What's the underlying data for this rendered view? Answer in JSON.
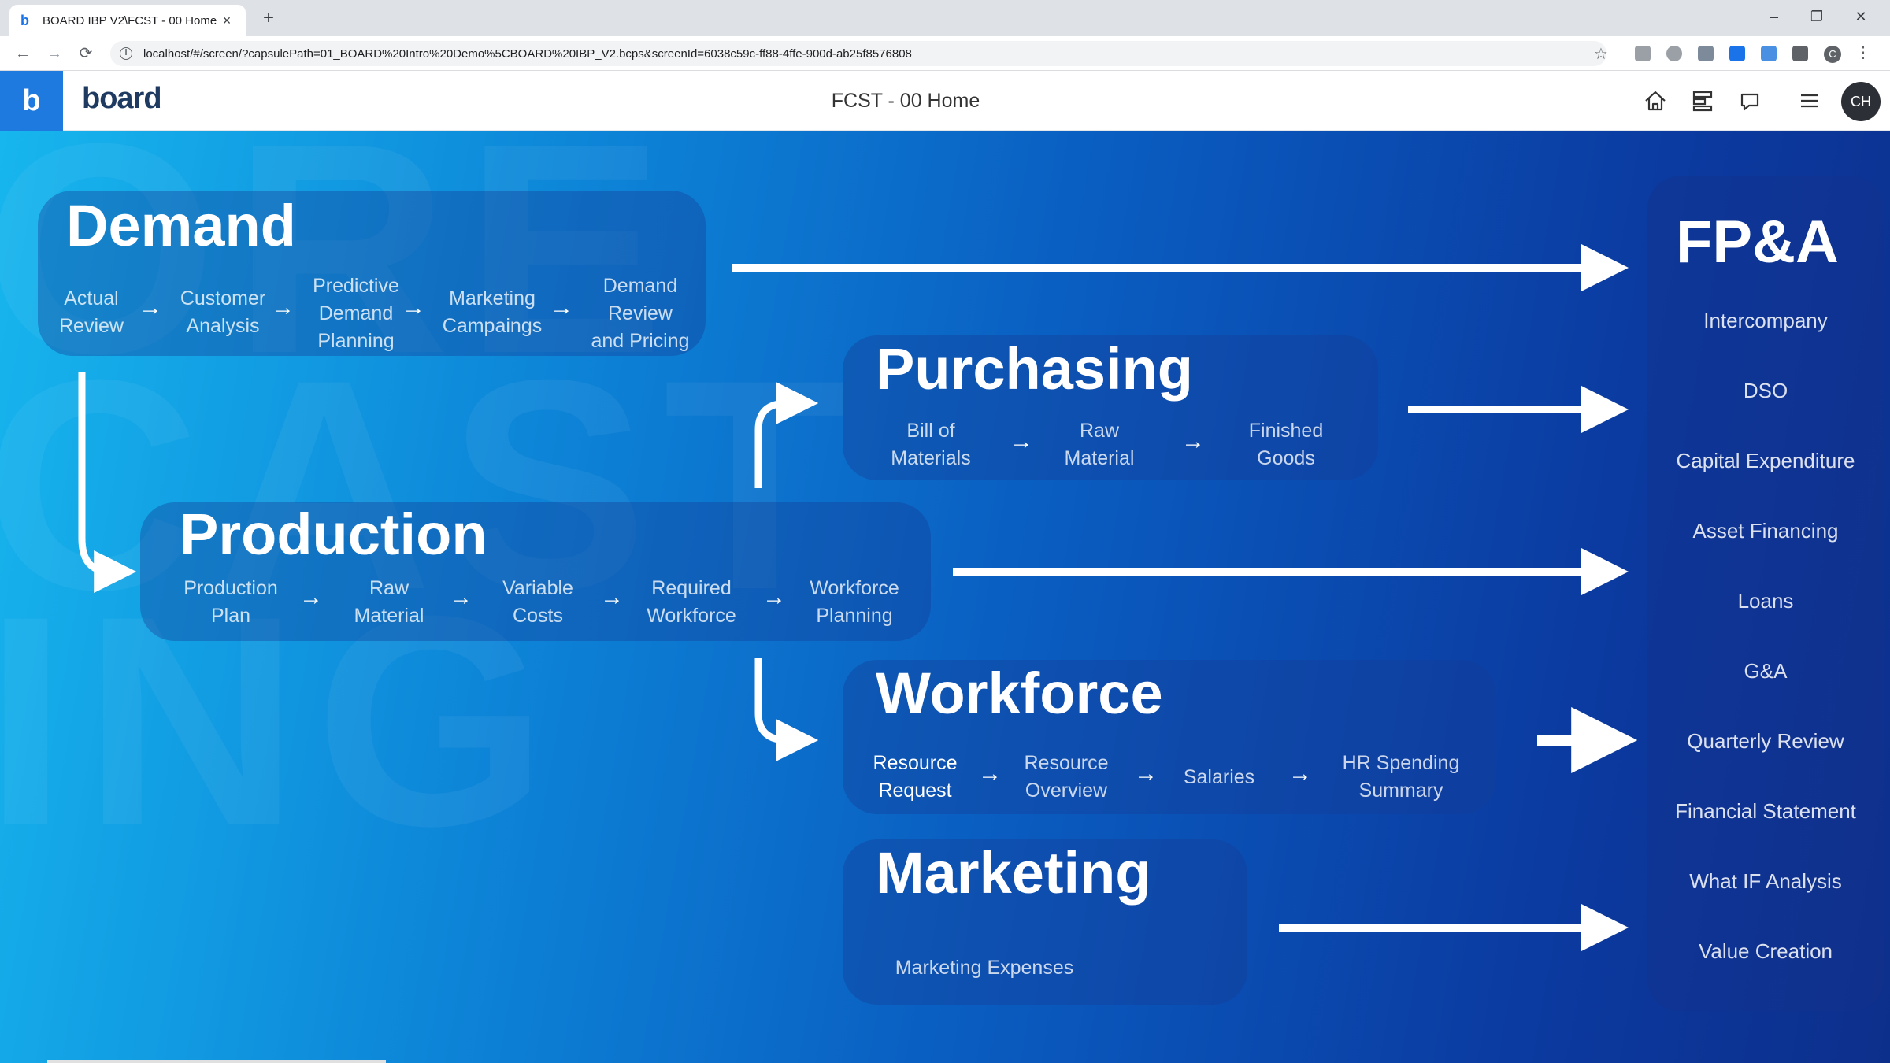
{
  "browser": {
    "tab_title": "BOARD IBP V2\\FCST - 00 Home",
    "tab_close": "×",
    "new_tab": "+",
    "url": "localhost/#/screen/?capsulePath=01_BOARD%20Intro%20Demo%5CBOARD%20IBP_V2.bcps&screenId=6038c59c-ff88-4ffe-900d-ab25f8576808",
    "profile_initial": "C",
    "back": "←",
    "forward": "→",
    "reload": "⟳",
    "minimize": "–",
    "restore": "❐",
    "close": "✕",
    "star": "☆",
    "kebab": "⋮",
    "info": "i"
  },
  "app": {
    "brand_square": "b",
    "logo": "board",
    "screen_title": "FCST - 00 Home",
    "user_initials": "CH"
  },
  "icons": {
    "home": "home-icon",
    "layout": "layout-icon",
    "chat": "chat-icon",
    "menu": "hamburger-menu-icon"
  },
  "watermark": "ORE\nCAST\nING",
  "colors": {
    "brand": "#1f7ae0",
    "bg_left": "#17b6ee",
    "bg_right": "#0d2f8c"
  },
  "demand": {
    "title": "Demand",
    "steps": [
      "Actual\nReview",
      "Customer\nAnalysis",
      "Predictive\nDemand\nPlanning",
      "Marketing\nCampaings",
      "Demand\nReview\nand Pricing"
    ]
  },
  "purchasing": {
    "title": "Purchasing",
    "steps": [
      "Bill of\nMaterials",
      "Raw\nMaterial",
      "Finished\nGoods"
    ]
  },
  "production": {
    "title": "Production",
    "steps": [
      "Production\nPlan",
      "Raw\nMaterial",
      "Variable\nCosts",
      "Required\nWorkforce",
      "Workforce\nPlanning"
    ]
  },
  "workforce": {
    "title": "Workforce",
    "steps": [
      "Resource\nRequest",
      "Resource\nOverview",
      "Salaries",
      "HR Spending\nSummary"
    ]
  },
  "marketing": {
    "title": "Marketing",
    "steps": [
      "Marketing Expenses"
    ]
  },
  "fpa": {
    "title": "FP&A",
    "items": [
      "Intercompany",
      "DSO",
      "Capital Expenditure",
      "Asset Financing",
      "Loans",
      "G&A",
      "Quarterly Review",
      "Financial Statement",
      "What IF Analysis",
      "Value Creation"
    ]
  },
  "arrow_glyph": "→"
}
